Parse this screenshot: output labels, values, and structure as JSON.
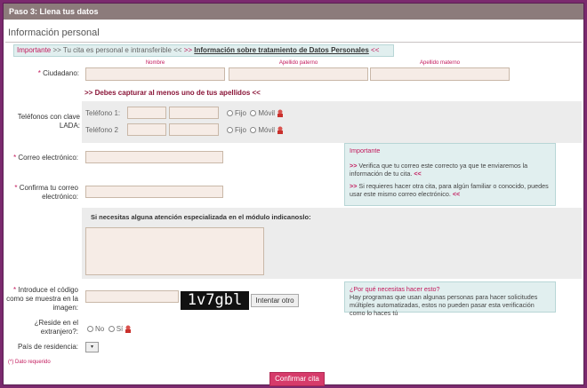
{
  "step_bar": "Paso 3: Llena tus datos",
  "section_title": "Información personal",
  "notice": {
    "important": "Importante",
    "text": ">> Tu cita es personal e intransferible <<",
    "sep": ">>",
    "link": "Información sobre tratamiento de Datos Personales",
    "end": "<<"
  },
  "ciudadano": {
    "label": "Ciudadano:",
    "cols": [
      "Nombre",
      "Apellido paterno",
      "Apellido materno"
    ],
    "note": ">> Debes capturar al menos uno de tus apellidos <<"
  },
  "telefonos": {
    "label": "Teléfonos con clave LADA:",
    "phone1": "Teléfono 1:",
    "phone2": "Teléfono 2",
    "fijo": "Fijo",
    "movil": "Móvil"
  },
  "correo": {
    "label": "Correo electrónico:"
  },
  "confirma_correo": {
    "label": "Confirma tu correo electrónico:"
  },
  "info_correo": {
    "title": "Importante",
    "p1a": ">>",
    "p1": "Verifica que tu correo este correcto ya que te enviaremos la información de tu cita.",
    "p1b": "<<",
    "p2a": ">>",
    "p2": "Si requieres hacer otra cita, para algún familiar o conocido, puedes usar este mismo correo electrónico.",
    "p2b": "<<"
  },
  "atencion": {
    "label": "Si necesitas alguna atención especializada en el módulo indicanoslo:"
  },
  "captcha": {
    "label": "Introduce el código como se muestra en la imagen:",
    "code": "1v7gbl",
    "retry": "Intentar otro"
  },
  "info_captcha": {
    "title": "¿Por qué necesitas hacer esto?",
    "text": "Hay programas que usan algunas personas para hacer solicitudes múltiples automatizadas, estos no pueden pasar esta verificación como lo haces tú"
  },
  "extranjero": {
    "label": "¿Reside en el extranjero?:",
    "no": "No",
    "si": "Sí"
  },
  "pais": {
    "label": "País de residencia:",
    "value": "▾"
  },
  "required_note": "(*) Dato requerido",
  "submit": "Confirmar cita",
  "colors": {
    "accent": "#c2185b",
    "frame": "#7b2a6e",
    "bar": "#8c7b7b"
  }
}
